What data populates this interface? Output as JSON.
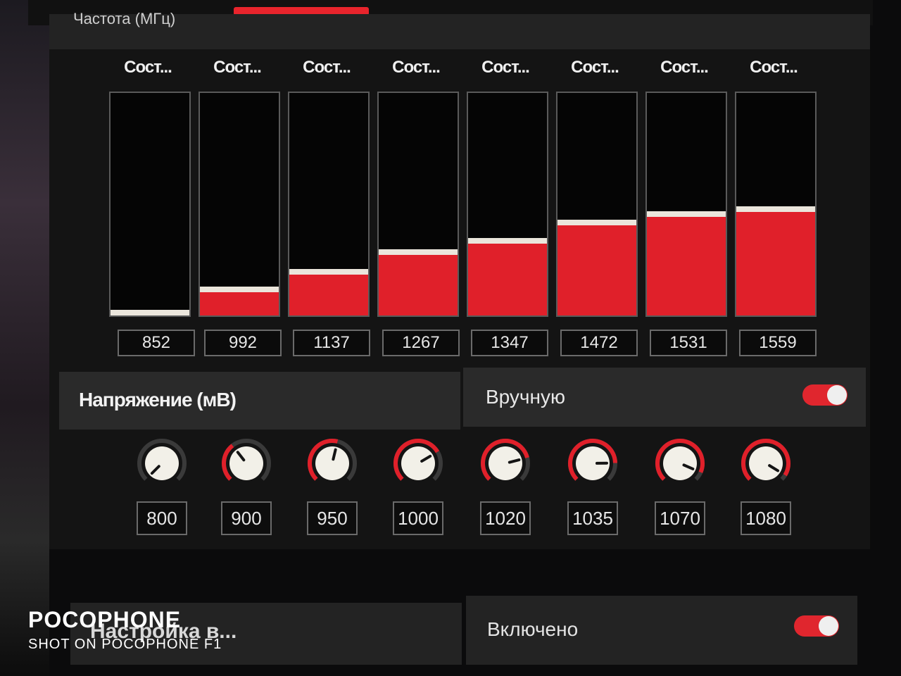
{
  "frequency": {
    "title": "Частота (МГц)",
    "state_labels": [
      "Сост...",
      "Сост...",
      "Сост...",
      "Сост...",
      "Сост...",
      "Сост...",
      "Сост...",
      "Сост..."
    ],
    "values": [
      "852",
      "992",
      "1137",
      "1267",
      "1347",
      "1472",
      "1531",
      "1559"
    ],
    "levels": [
      0,
      0.11,
      0.19,
      0.28,
      0.33,
      0.41,
      0.45,
      0.47
    ]
  },
  "voltage": {
    "title": "Напряжение (мВ)",
    "manual_label": "Вручную",
    "manual_on": true,
    "values": [
      "800",
      "900",
      "950",
      "1000",
      "1020",
      "1035",
      "1070",
      "1080"
    ],
    "levels": [
      0,
      0.36,
      0.55,
      0.72,
      0.78,
      0.83,
      0.92,
      0.95
    ]
  },
  "tuning": {
    "title": "Настройка в...",
    "status_label": "Включено",
    "enabled": true
  },
  "watermark": {
    "brand": "POCOPHONE",
    "sub": "SHOT ON POCOPHONE F1"
  },
  "colors": {
    "accent": "#e0202a",
    "panel": "#141414",
    "header": "#2a2a2a"
  }
}
